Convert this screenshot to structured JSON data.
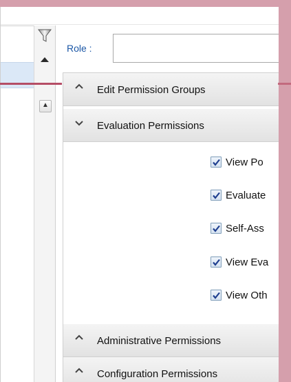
{
  "colors": {
    "frame": "#d59fac",
    "accent_red": "#b54d66",
    "role_label": "#1b57a6",
    "checkbox_check": "#1f3f8f"
  },
  "filter": {
    "icon": "funnel-icon"
  },
  "role": {
    "label": "Role :",
    "value": ""
  },
  "accordion": {
    "sections": [
      {
        "title": "Edit Permission Groups",
        "expanded": false,
        "icon": "chevron-up-icon"
      },
      {
        "title": "Evaluation Permissions",
        "expanded": true,
        "icon": "chevron-down-icon"
      },
      {
        "title": "Administrative Permissions",
        "expanded": false,
        "icon": "chevron-up-icon"
      },
      {
        "title": "Configuration Permissions",
        "expanded": false,
        "icon": "chevron-up-icon"
      }
    ],
    "evaluation_permissions": [
      {
        "label": "View Po",
        "checked": true
      },
      {
        "label": "Evaluate",
        "checked": true
      },
      {
        "label": "Self-Ass",
        "checked": true
      },
      {
        "label": "View Eva",
        "checked": true
      },
      {
        "label": "View Oth",
        "checked": true
      }
    ]
  }
}
